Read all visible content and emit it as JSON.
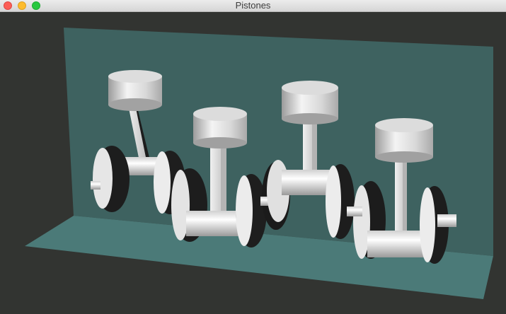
{
  "window": {
    "title": "Pistones",
    "controls": [
      "close",
      "minimize",
      "maximize"
    ]
  },
  "scene": {
    "background": "#323431",
    "wall_color": "#3e6260",
    "floor_color": "#4b7a78",
    "part_color": "#e8e8e8",
    "shadow_color": "#1c1c1c",
    "piston_count": 4
  }
}
